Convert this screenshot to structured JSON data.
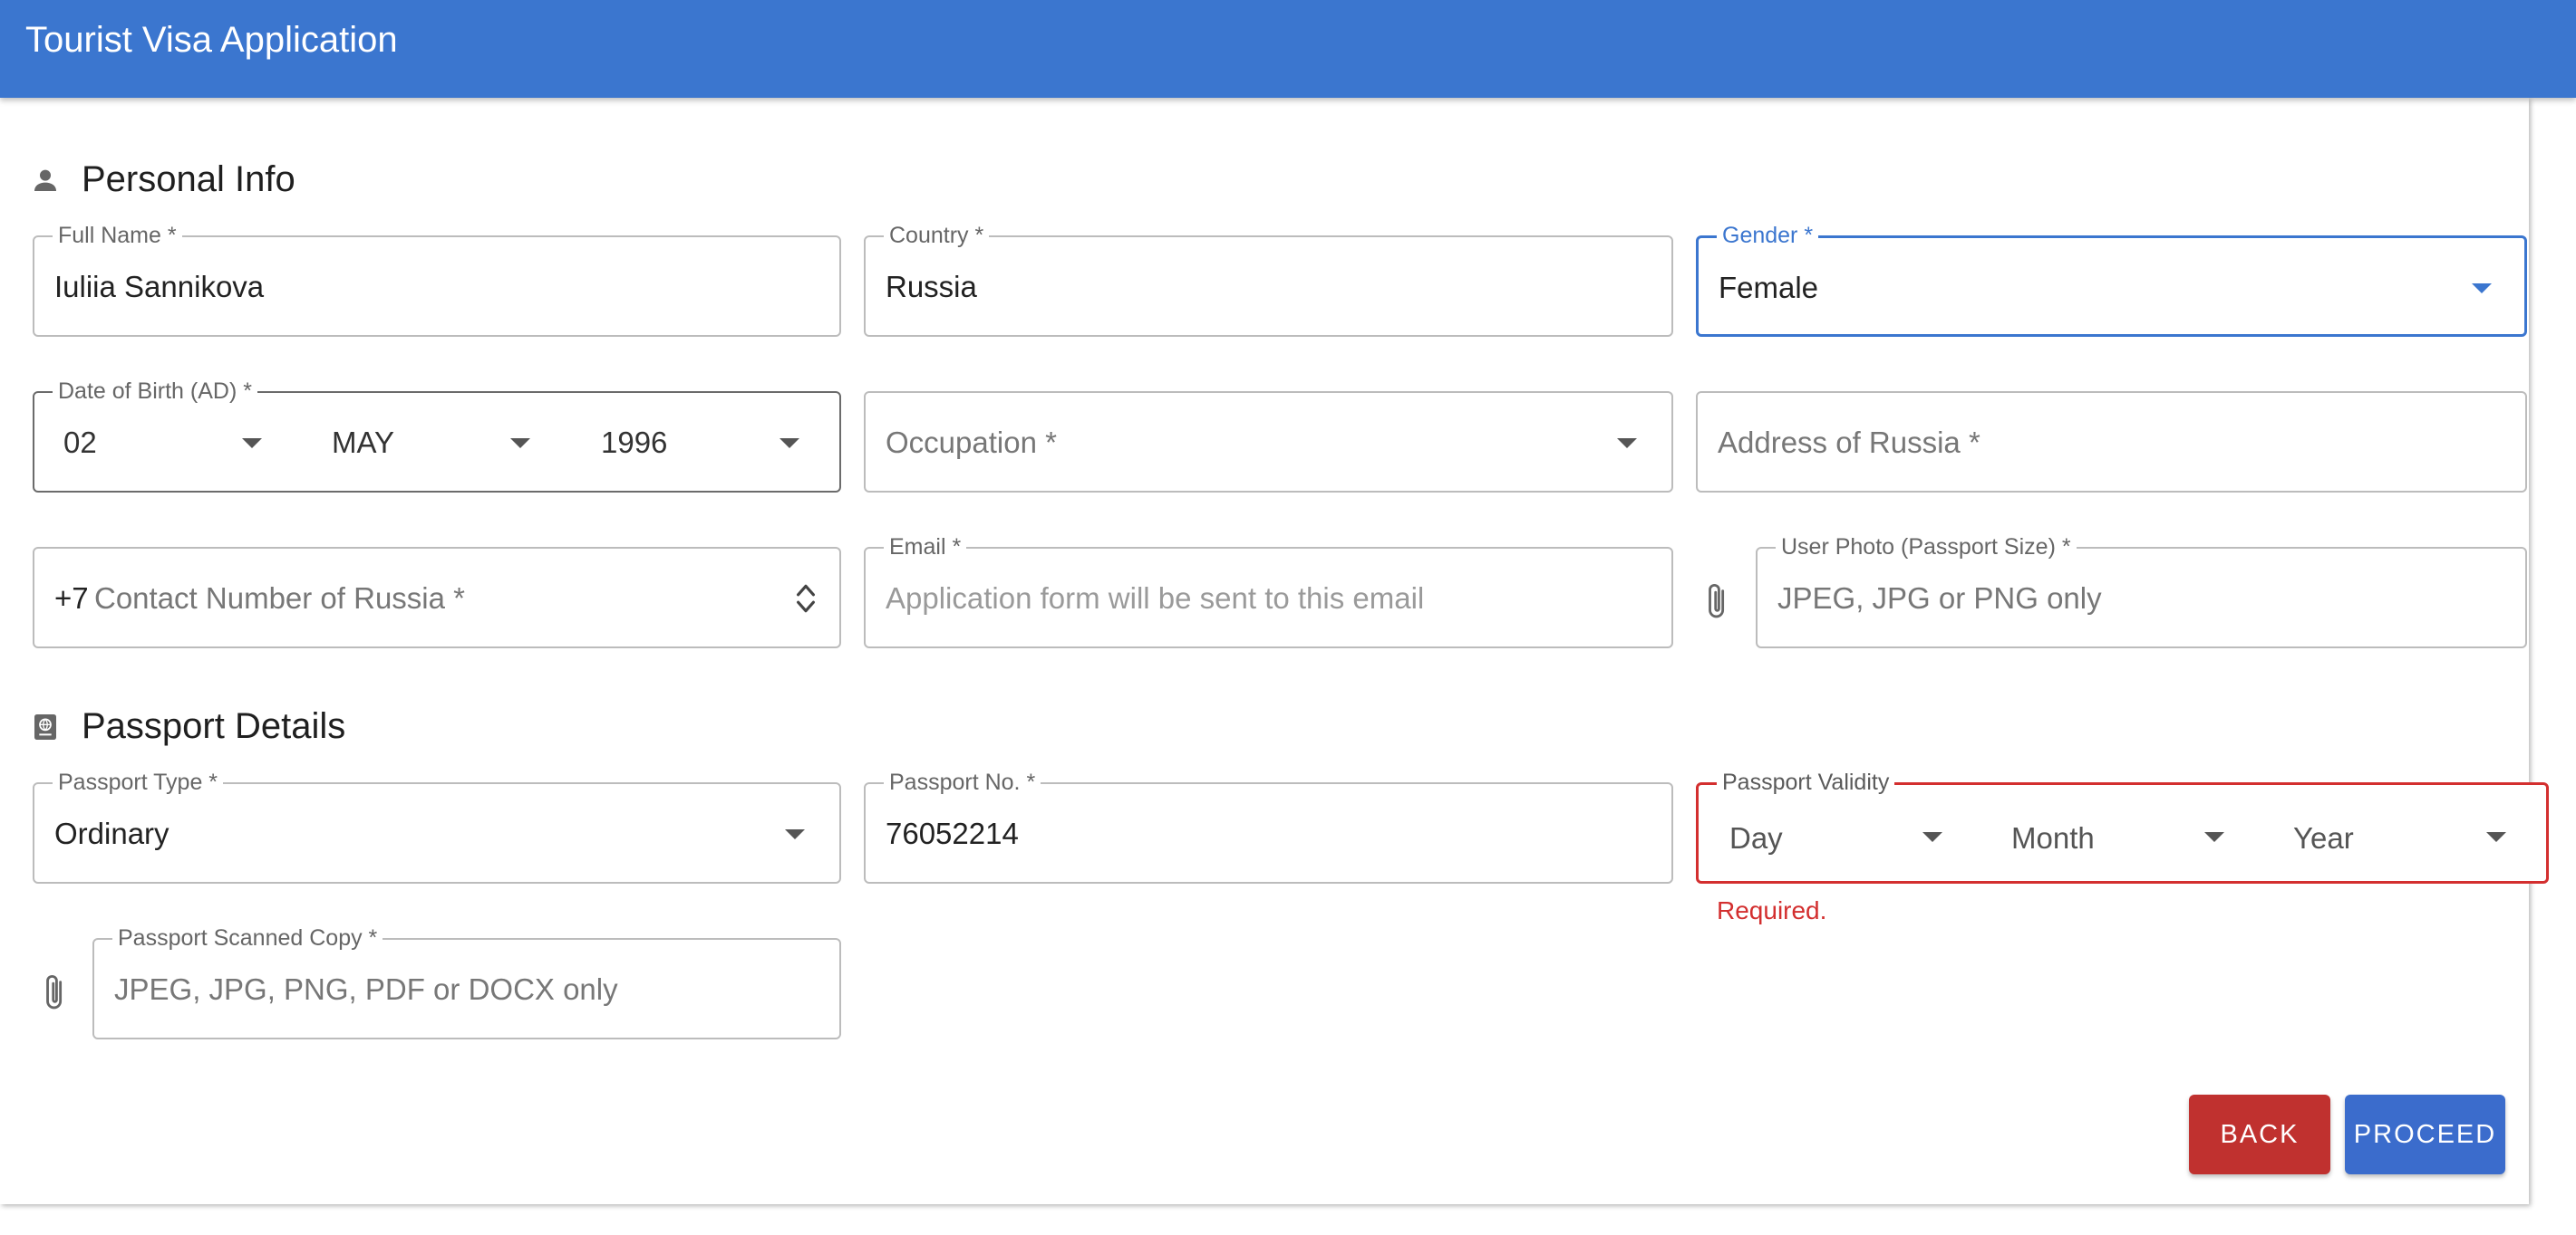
{
  "app": {
    "title": "Tourist Visa Application"
  },
  "personal": {
    "heading": "Personal Info",
    "full_name": {
      "label": "Full Name *",
      "value": "Iuliia Sannikova"
    },
    "country": {
      "label": "Country *",
      "value": "Russia"
    },
    "gender": {
      "label": "Gender *",
      "value": "Female"
    },
    "dob": {
      "label": "Date of Birth (AD) *",
      "day": "02",
      "month": "MAY",
      "year": "1996"
    },
    "occupation": {
      "placeholder": "Occupation *"
    },
    "address": {
      "placeholder": "Address of Russia *"
    },
    "contact": {
      "prefix": "+7",
      "placeholder": "Contact Number of Russia *"
    },
    "email": {
      "label": "Email *",
      "placeholder": "Application form will be sent to this email"
    },
    "photo": {
      "label": "User Photo (Passport Size) *",
      "placeholder": "JPEG, JPG or PNG only"
    }
  },
  "passport": {
    "heading": "Passport Details",
    "type": {
      "label": "Passport Type *",
      "value": "Ordinary"
    },
    "number": {
      "label": "Passport No. *",
      "value": "76052214"
    },
    "validity": {
      "label": "Passport Validity",
      "day": "Day",
      "month": "Month",
      "year": "Year",
      "error": "Required."
    },
    "scan": {
      "label": "Passport Scanned Copy *",
      "placeholder": "JPEG, JPG, PNG, PDF or DOCX only"
    }
  },
  "actions": {
    "back": "BACK",
    "proceed": "PROCEED"
  },
  "icons": {
    "personal": "person-icon",
    "passport": "passport-icon",
    "attach": "paperclip-icon",
    "dropdown": "chevron-down-icon",
    "spinner": "spinner-arrows-icon"
  },
  "colors": {
    "primary": "#3b76cf",
    "error": "#d32f2f",
    "back": "#c0312f"
  }
}
